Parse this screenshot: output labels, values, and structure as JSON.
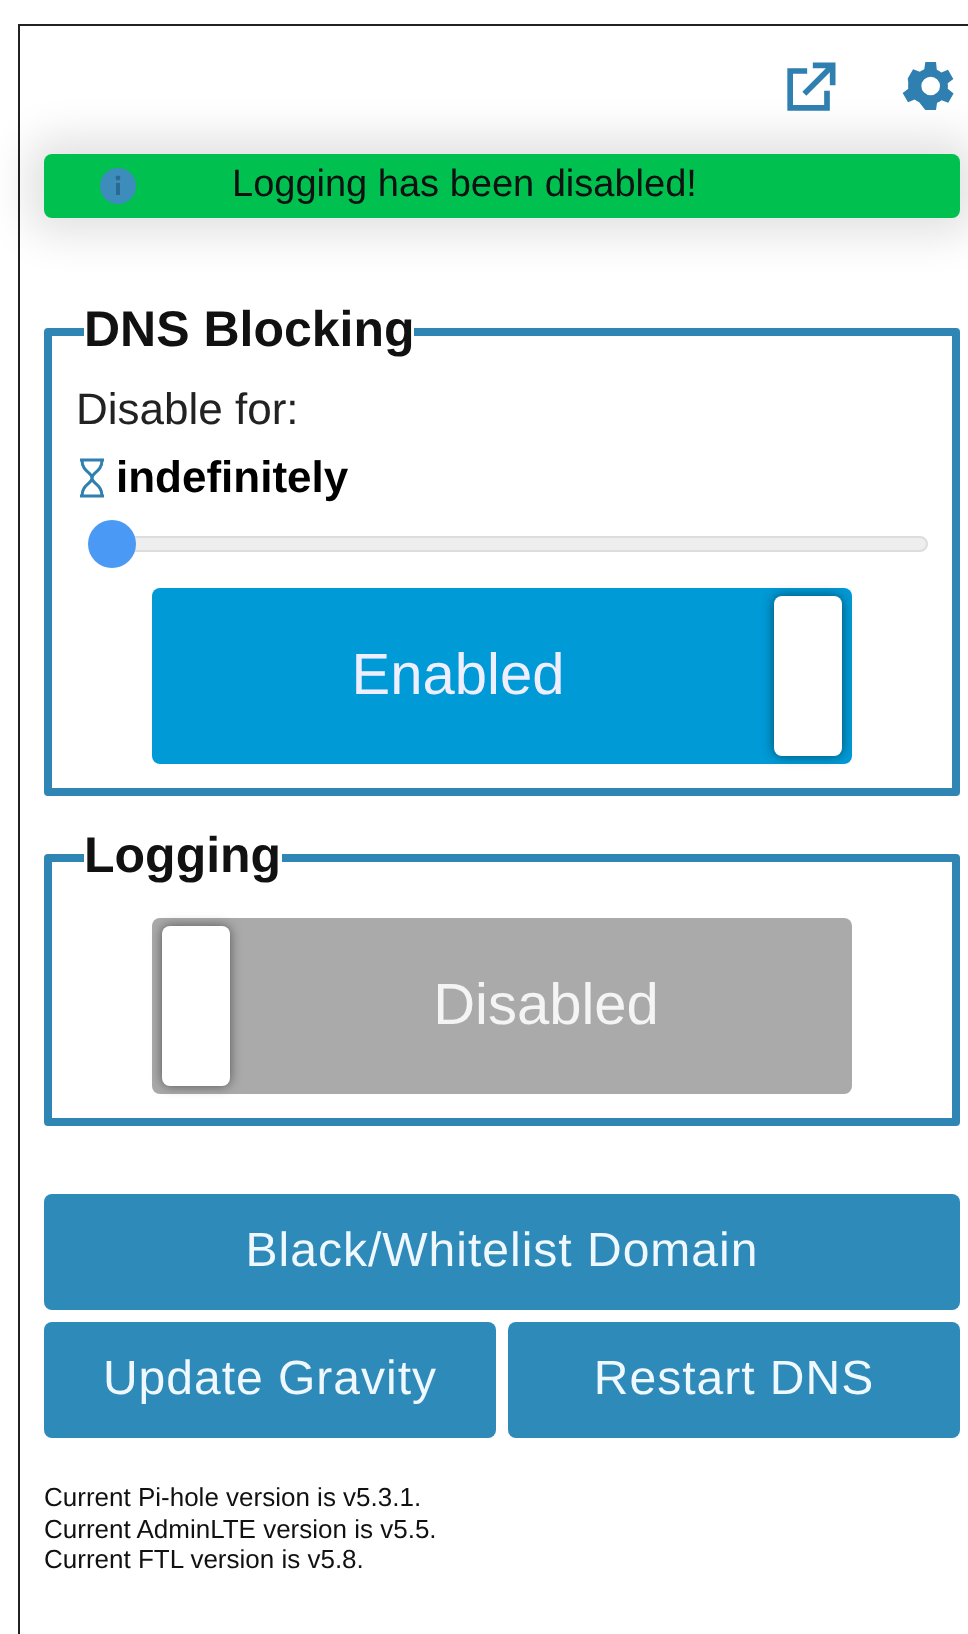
{
  "notification": {
    "text": "Logging has been disabled!"
  },
  "sections": [
    {
      "title": "DNS Blocking",
      "disable_label": "Disable for:",
      "duration": "indefinitely",
      "slider": {
        "level": 0
      },
      "toggle": {
        "label": "Enabled",
        "on": true
      }
    },
    {
      "title": "Logging",
      "toggle": {
        "label": "Disabled",
        "on": false
      }
    }
  ],
  "buttons": [
    {
      "label": "Black/Whitelist Domain"
    },
    {
      "label": "Update Gravity"
    },
    {
      "label": "Restart DNS"
    }
  ],
  "versions": [
    "Current Pi-hole version is v5.3.1.",
    "Current AdminLTE version is v5.5.",
    "Current FTL version is v5.8."
  ]
}
